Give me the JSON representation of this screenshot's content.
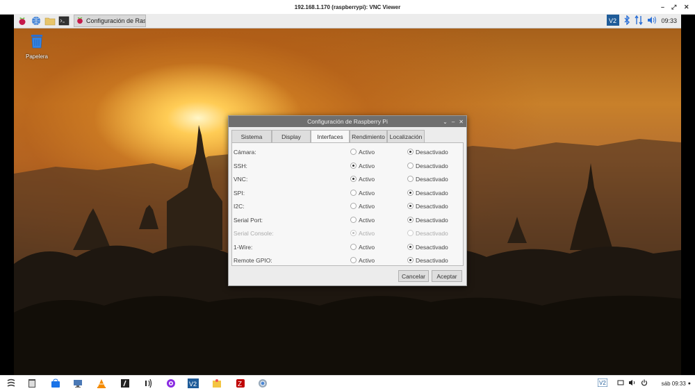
{
  "vnc": {
    "title": "192.168.1.170 (raspberrypi): VNC Viewer",
    "minimize": "–",
    "restore": "⤢",
    "close": "✕"
  },
  "rpi_panel": {
    "task_label": "Configuración de Ras...",
    "clock": "09:33"
  },
  "desktop": {
    "trash_label": "Papelera"
  },
  "dialog": {
    "title": "Configuración de Raspberry Pi",
    "tabs": [
      {
        "label": "Sistema",
        "active": false
      },
      {
        "label": "Display",
        "active": false
      },
      {
        "label": "Interfaces",
        "active": true
      },
      {
        "label": "Rendimiento",
        "active": false
      },
      {
        "label": "Localización",
        "active": false
      }
    ],
    "option_on": "Activo",
    "option_off": "Desactivado",
    "interfaces": [
      {
        "label": "Cámara:",
        "value": "off",
        "disabled": false
      },
      {
        "label": "SSH:",
        "value": "on",
        "disabled": false
      },
      {
        "label": "VNC:",
        "value": "on",
        "disabled": false
      },
      {
        "label": "SPI:",
        "value": "off",
        "disabled": false
      },
      {
        "label": "I2C:",
        "value": "off",
        "disabled": false
      },
      {
        "label": "Serial Port:",
        "value": "off",
        "disabled": false
      },
      {
        "label": "Serial Console:",
        "value": "on",
        "disabled": true
      },
      {
        "label": "1-Wire:",
        "value": "off",
        "disabled": false
      },
      {
        "label": "Remote GPIO:",
        "value": "off",
        "disabled": false
      }
    ],
    "cancel": "Cancelar",
    "accept": "Aceptar"
  },
  "host_taskbar": {
    "clock": "sáb 09:33"
  },
  "colors": {
    "vnc_brand": "#1f5c99",
    "dialog_titlebar": "#6f6f6f",
    "bluetooth": "#2a6fd6",
    "network": "#2a6fd6"
  }
}
